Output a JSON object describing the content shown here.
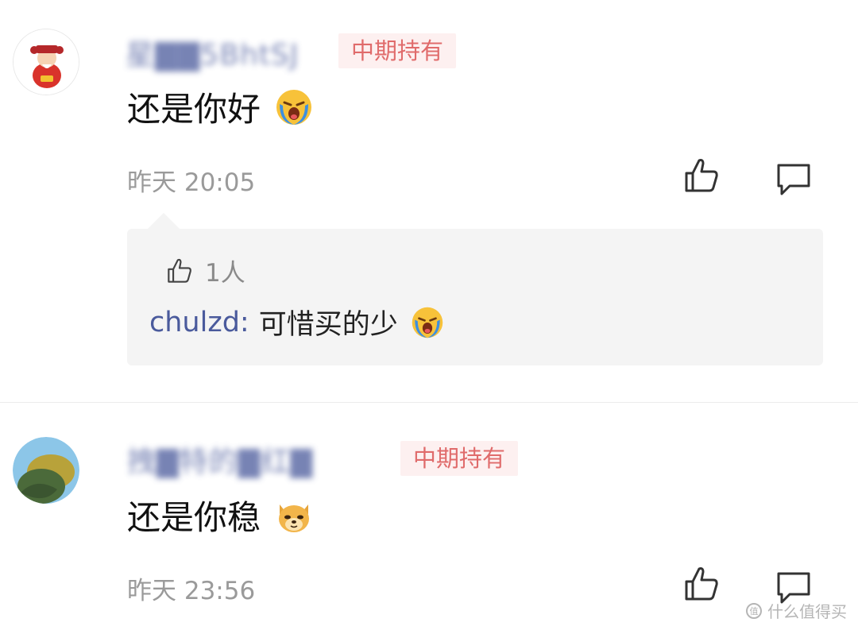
{
  "comments": [
    {
      "username": "星▇▇5BhtSJ",
      "badge": "中期持有",
      "text": "还是你好",
      "emoji": "crying-face-emoji",
      "timestamp": "昨天 20:05",
      "reply": {
        "likes": "1人",
        "author": "chulzd:",
        "text": "可惜买的少",
        "emoji": "crying-face-emoji"
      }
    },
    {
      "username": "拽▇特的▇红▇",
      "badge": "中期持有",
      "text": "还是你稳",
      "emoji": "doge-face-emoji",
      "timestamp": "昨天 23:56"
    }
  ],
  "watermark": "什么值得买",
  "colors": {
    "username": "#4a5a9c",
    "badge_text": "#e06b6b",
    "badge_bg": "#fdf0f0",
    "timestamp": "#9a9a9a",
    "reply_bg": "#f4f4f4"
  }
}
